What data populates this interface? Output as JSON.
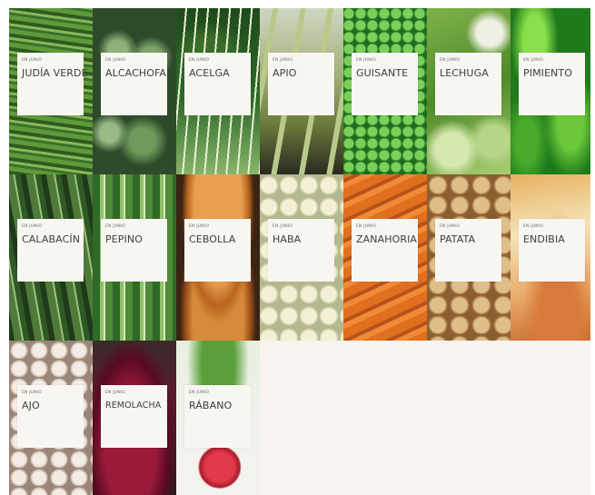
{
  "season_label": "EN JUNIO",
  "tiles": [
    {
      "name": "JUDÍA VERDE"
    },
    {
      "name": "ALCACHOFA"
    },
    {
      "name": "ACELGA"
    },
    {
      "name": "APIO"
    },
    {
      "name": "GUISANTE"
    },
    {
      "name": "LECHUGA"
    },
    {
      "name": "PIMIENTO"
    },
    {
      "name": "CALABACÍN"
    },
    {
      "name": "PEPINO"
    },
    {
      "name": "CEBOLLA"
    },
    {
      "name": "HABA"
    },
    {
      "name": "ZANAHORIA"
    },
    {
      "name": "PATATA"
    },
    {
      "name": "ENDIBIA"
    },
    {
      "name": "AJO"
    },
    {
      "name": "REMOLACHA"
    },
    {
      "name": "RÁBANO"
    }
  ]
}
